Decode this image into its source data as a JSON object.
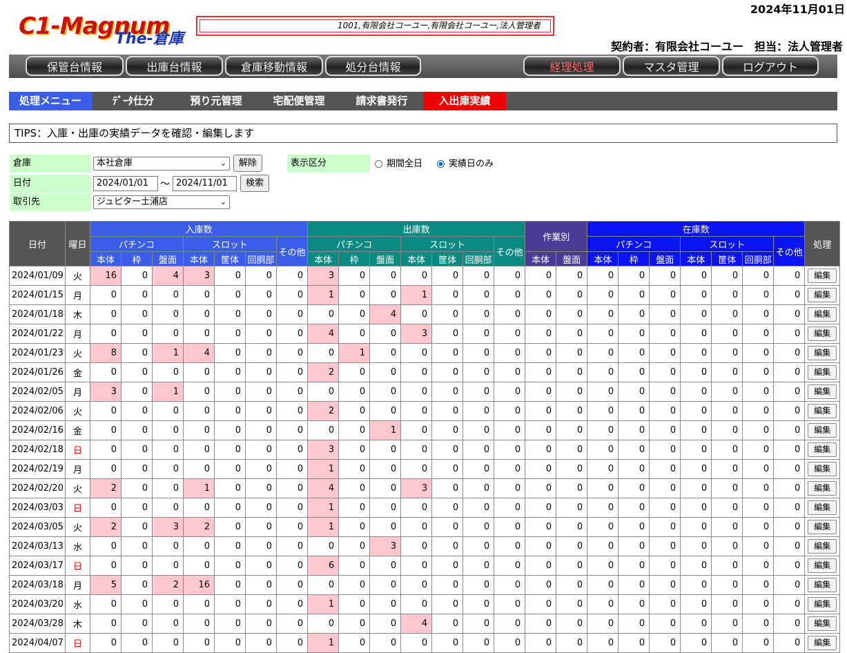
{
  "header": {
    "date": "2024年11月01日",
    "logo_c1": "C1-Magnum",
    "logo_the": "The-倉庫",
    "info": "1001,有限会社コーユー,有限会社コーユー,法人管理者",
    "contract": "契約者：有限会社コーユー　担当：法人管理者"
  },
  "main_nav": [
    {
      "label": "保管台情報"
    },
    {
      "label": "出庫台情報"
    },
    {
      "label": "倉庫移動情報"
    },
    {
      "label": "処分台情報"
    },
    {
      "label": "経理処理"
    },
    {
      "label": "マスタ管理"
    },
    {
      "label": "ログアウト"
    }
  ],
  "sub_nav": [
    {
      "label": "処理メニュー",
      "color": "#3b5ee8"
    },
    {
      "label": "ﾃﾞｰﾀ仕分"
    },
    {
      "label": "預り元管理"
    },
    {
      "label": "宅配便管理"
    },
    {
      "label": "請求書発行"
    },
    {
      "label": "入出庫実績",
      "color": "#ee0000"
    }
  ],
  "tips": "TIPS：入庫・出庫の実績データを確認・編集します",
  "filters": {
    "warehouse_label": "倉庫",
    "warehouse_value": "本社倉庫",
    "clear_label": "解除",
    "date_label": "日付",
    "date_from": "2024/01/01",
    "date_sep": "～",
    "date_to": "2024/11/01",
    "search_label": "検索",
    "client_label": "取引先",
    "client_value": "ジュピター土浦店",
    "display_label": "表示区分",
    "radio_all": "期間全日",
    "radio_actual": "実績日のみ",
    "selected": "actual"
  },
  "table": {
    "headers": {
      "date": "日付",
      "weekday": "曜日",
      "in": "入庫数",
      "out": "出庫数",
      "work": "作業別",
      "stock": "在庫数",
      "action": "処理",
      "pachinko": "パチンコ",
      "slot": "スロット",
      "other": "その他",
      "p_cols": [
        "本体",
        "枠",
        "盤面"
      ],
      "s_cols": [
        "本体",
        "筐体",
        "回胴部"
      ],
      "work_cols": [
        "本体",
        "盤面"
      ]
    },
    "edit_label": "編集",
    "rows": [
      {
        "date": "2024/01/09",
        "wd": "火",
        "in": [
          16,
          0,
          4,
          3,
          0,
          0,
          0
        ],
        "out": [
          3,
          0,
          0,
          0,
          0,
          0,
          0
        ]
      },
      {
        "date": "2024/01/15",
        "wd": "月",
        "in": [
          0,
          0,
          0,
          0,
          0,
          0,
          0
        ],
        "out": [
          1,
          0,
          0,
          1,
          0,
          0,
          0
        ]
      },
      {
        "date": "2024/01/18",
        "wd": "木",
        "in": [
          0,
          0,
          0,
          0,
          0,
          0,
          0
        ],
        "out": [
          0,
          0,
          4,
          0,
          0,
          0,
          0
        ]
      },
      {
        "date": "2024/01/22",
        "wd": "月",
        "in": [
          0,
          0,
          0,
          0,
          0,
          0,
          0
        ],
        "out": [
          4,
          0,
          0,
          3,
          0,
          0,
          0
        ]
      },
      {
        "date": "2024/01/23",
        "wd": "火",
        "in": [
          8,
          0,
          1,
          4,
          0,
          0,
          0
        ],
        "out": [
          0,
          1,
          0,
          0,
          0,
          0,
          0
        ]
      },
      {
        "date": "2024/01/26",
        "wd": "金",
        "in": [
          0,
          0,
          0,
          0,
          0,
          0,
          0
        ],
        "out": [
          2,
          0,
          0,
          0,
          0,
          0,
          0
        ]
      },
      {
        "date": "2024/02/05",
        "wd": "月",
        "in": [
          3,
          0,
          1,
          0,
          0,
          0,
          0
        ],
        "out": [
          0,
          0,
          0,
          0,
          0,
          0,
          0
        ]
      },
      {
        "date": "2024/02/06",
        "wd": "火",
        "in": [
          0,
          0,
          0,
          0,
          0,
          0,
          0
        ],
        "out": [
          2,
          0,
          0,
          0,
          0,
          0,
          0
        ]
      },
      {
        "date": "2024/02/16",
        "wd": "金",
        "in": [
          0,
          0,
          0,
          0,
          0,
          0,
          0
        ],
        "out": [
          0,
          0,
          1,
          0,
          0,
          0,
          0
        ]
      },
      {
        "date": "2024/02/18",
        "wd": "日",
        "in": [
          0,
          0,
          0,
          0,
          0,
          0,
          0
        ],
        "out": [
          3,
          0,
          0,
          0,
          0,
          0,
          0
        ]
      },
      {
        "date": "2024/02/19",
        "wd": "月",
        "in": [
          0,
          0,
          0,
          0,
          0,
          0,
          0
        ],
        "out": [
          1,
          0,
          0,
          0,
          0,
          0,
          0
        ]
      },
      {
        "date": "2024/02/20",
        "wd": "火",
        "in": [
          2,
          0,
          0,
          1,
          0,
          0,
          0
        ],
        "out": [
          4,
          0,
          0,
          3,
          0,
          0,
          0
        ]
      },
      {
        "date": "2024/03/03",
        "wd": "日",
        "in": [
          0,
          0,
          0,
          0,
          0,
          0,
          0
        ],
        "out": [
          1,
          0,
          0,
          0,
          0,
          0,
          0
        ]
      },
      {
        "date": "2024/03/05",
        "wd": "火",
        "in": [
          2,
          0,
          3,
          2,
          0,
          0,
          0
        ],
        "out": [
          1,
          0,
          0,
          0,
          0,
          0,
          0
        ]
      },
      {
        "date": "2024/03/13",
        "wd": "水",
        "in": [
          0,
          0,
          0,
          0,
          0,
          0,
          0
        ],
        "out": [
          0,
          0,
          3,
          0,
          0,
          0,
          0
        ]
      },
      {
        "date": "2024/03/17",
        "wd": "日",
        "in": [
          0,
          0,
          0,
          0,
          0,
          0,
          0
        ],
        "out": [
          6,
          0,
          0,
          0,
          0,
          0,
          0
        ]
      },
      {
        "date": "2024/03/18",
        "wd": "月",
        "in": [
          5,
          0,
          2,
          16,
          0,
          0,
          0
        ],
        "out": [
          0,
          0,
          0,
          0,
          0,
          0,
          0
        ]
      },
      {
        "date": "2024/03/20",
        "wd": "水",
        "in": [
          0,
          0,
          0,
          0,
          0,
          0,
          0
        ],
        "out": [
          1,
          0,
          0,
          0,
          0,
          0,
          0
        ]
      },
      {
        "date": "2024/03/28",
        "wd": "木",
        "in": [
          0,
          0,
          0,
          0,
          0,
          0,
          0
        ],
        "out": [
          0,
          0,
          0,
          4,
          0,
          0,
          0
        ]
      },
      {
        "date": "2024/04/07",
        "wd": "日",
        "in": [
          0,
          0,
          0,
          0,
          0,
          0,
          0
        ],
        "out": [
          1,
          0,
          0,
          0,
          0,
          0,
          0
        ]
      }
    ]
  }
}
